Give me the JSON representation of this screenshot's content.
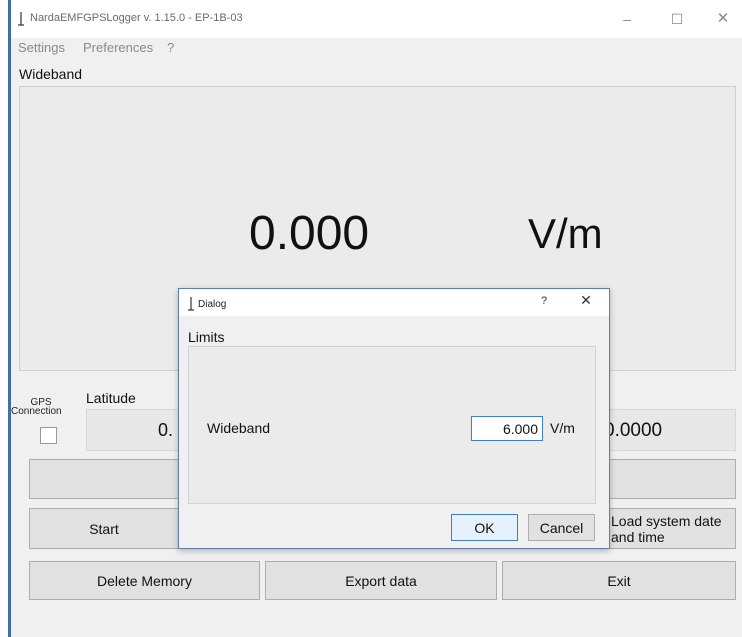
{
  "window": {
    "title": "NardaEMFGPSLogger v. 1.15.0 - EP-1B-03",
    "controls": {
      "minimize": "–",
      "maximize": "☐",
      "close": "✕"
    }
  },
  "menu": {
    "items": [
      "Settings",
      "Preferences",
      "?"
    ]
  },
  "display": {
    "section_label": "Wideband",
    "value": "0.000",
    "unit": "V/m"
  },
  "gps": {
    "label": "GPS",
    "connection_label": "Connection",
    "connected": false,
    "latitude_label": "Latitude",
    "latitude_value_partial": "0.",
    "longitude_value_partial": "0.0000"
  },
  "buttons": {
    "start": "Start",
    "load_system_date": "Load system date and time",
    "delete_memory": "Delete Memory",
    "export_data": "Export data",
    "exit": "Exit"
  },
  "dialog": {
    "title": "Dialog",
    "help": "?",
    "close": "✕",
    "group_label": "Limits",
    "field_label": "Wideband",
    "field_value": "6.000",
    "field_unit": "V/m",
    "ok": "OK",
    "cancel": "Cancel"
  },
  "colors": {
    "accent": "#3c7fd0",
    "window_border": "#3f6fa6",
    "panel": "#ebebeb"
  }
}
